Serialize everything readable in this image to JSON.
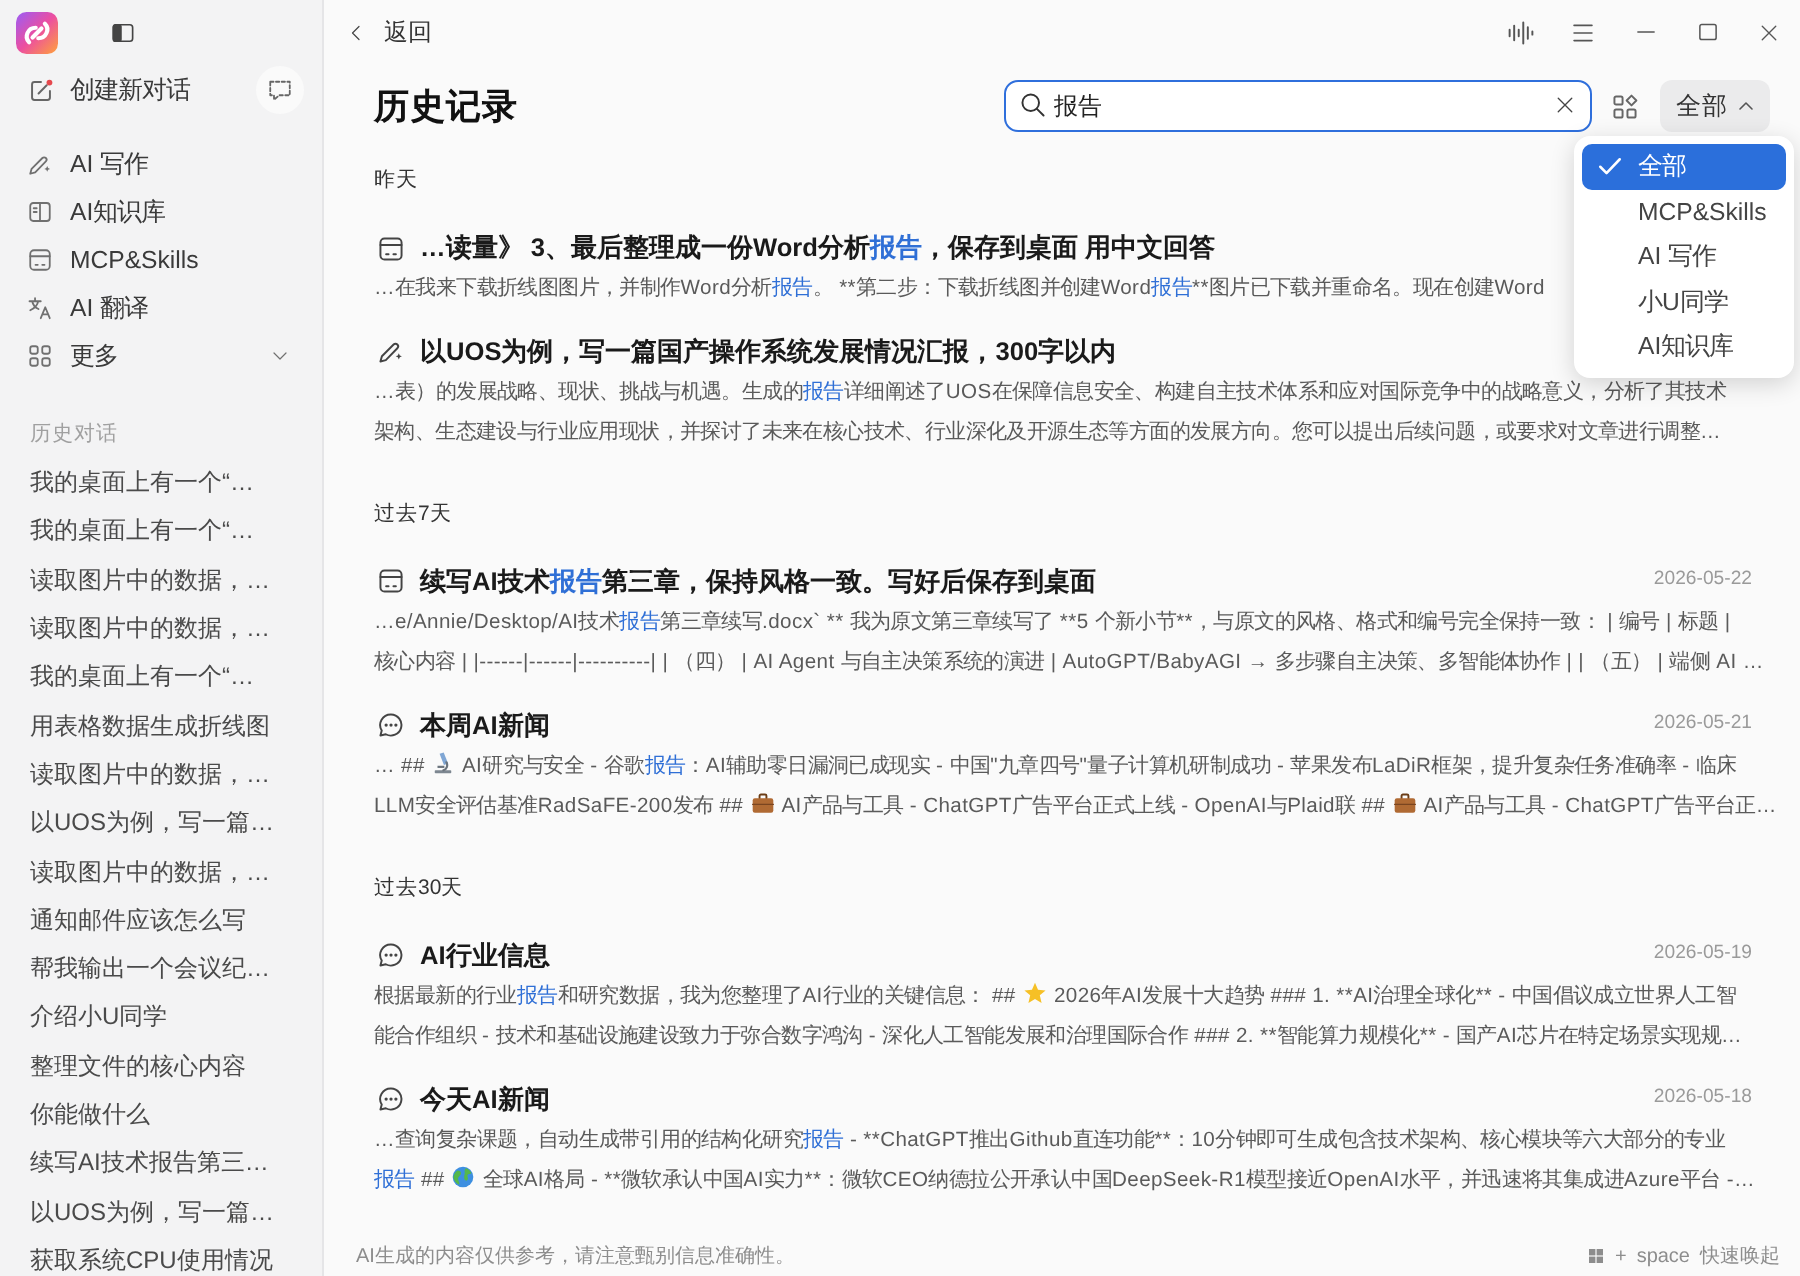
{
  "sidebar": {
    "new_chat": "创建新对话",
    "nav_items": [
      {
        "kind": "writing",
        "label": "AI 写作"
      },
      {
        "kind": "knowledge",
        "label": "AI知识库"
      },
      {
        "kind": "skills",
        "label": "MCP&Skills"
      },
      {
        "kind": "translate",
        "label": "AI 翻译"
      },
      {
        "kind": "more",
        "label": "更多"
      }
    ],
    "history_label": "历史对话",
    "history_items": [
      "我的桌面上有一个“…",
      "我的桌面上有一个“…",
      "读取图片中的数据，…",
      "读取图片中的数据，…",
      "我的桌面上有一个“…",
      "用表格数据生成折线图",
      "读取图片中的数据，…",
      "以UOS为例，写一篇…",
      "读取图片中的数据，…",
      "通知邮件应该怎么写",
      "帮我输出一个会议纪…",
      "介绍小U同学",
      "整理文件的核心内容",
      "你能做什么",
      "续写AI技术报告第三…",
      "以UOS为例，写一篇…",
      "获取系统CPU使用情况"
    ]
  },
  "topbar": {
    "back": "返回"
  },
  "header": {
    "title": "历史记录",
    "search": {
      "value": "报告"
    },
    "filter": {
      "label": "全部",
      "expanded": true,
      "options": [
        {
          "label": "全部",
          "selected": true
        },
        {
          "label": "MCP&Skills",
          "selected": false
        },
        {
          "label": "AI 写作",
          "selected": false
        },
        {
          "label": "小U同学",
          "selected": false
        },
        {
          "label": "AI知识库",
          "selected": false
        }
      ]
    }
  },
  "groups": [
    {
      "label": "昨天",
      "results": [
        {
          "kind": "skills",
          "title": [
            {
              "kind": "text",
              "text": "…读量》 3、最后整理成一份Word分析"
            },
            {
              "kind": "match",
              "text": "报告"
            },
            {
              "kind": "text",
              "text": "，保存到桌面 用中文回答"
            }
          ],
          "snippet_lines": [
            [
              {
                "kind": "text",
                "text": "…在我来下载折线图图片，并制作Word分析"
              },
              {
                "kind": "match",
                "text": "报告"
              },
              {
                "kind": "text",
                "text": "。 **第二步：下载折线图并创建Word"
              },
              {
                "kind": "match",
                "text": "报告"
              },
              {
                "kind": "text",
                "text": "**图片已下载并重命名。现在创建Word"
              }
            ]
          ]
        },
        {
          "kind": "writing",
          "title": [
            {
              "kind": "text",
              "text": "以UOS为例，写一篇国产操作系统发展情况汇报，300字以内"
            }
          ],
          "snippet_lines": [
            [
              {
                "kind": "text",
                "text": "…表）的发展战略、现状、挑战与机遇。生成的"
              },
              {
                "kind": "match",
                "text": "报告"
              },
              {
                "kind": "text",
                "text": "详细阐述了UOS在保障信息安全、构建自主技术体系和应对国际竞争中的战略意义，分析了其技术"
              }
            ],
            [
              {
                "kind": "text",
                "text": "架构、生态建设与行业应用现状，并探讨了未来在核心技术、行业深化及开源生态等方面的发展方向。您可以提出后续问题，或要求对文章进行调整…"
              }
            ]
          ]
        }
      ]
    },
    {
      "label": "过去7天",
      "results": [
        {
          "kind": "skills",
          "date": "2026-05-22",
          "title": [
            {
              "kind": "text",
              "text": "续写AI技术"
            },
            {
              "kind": "match",
              "text": "报告"
            },
            {
              "kind": "text",
              "text": "第三章，保持风格一致。写好后保存到桌面"
            }
          ],
          "snippet_lines": [
            [
              {
                "kind": "text",
                "text": "…e/Annie/Desktop/AI技术"
              },
              {
                "kind": "match",
                "text": "报告"
              },
              {
                "kind": "text",
                "text": "第三章续写.docx` ** 我为原文第三章续写了 **5 个新小节**，与原文的风格、格式和编号完全保持一致： | 编号 | 标题 |"
              }
            ],
            [
              {
                "kind": "text",
                "text": "核心内容 | |------|------|----------| | （四） | AI Agent 与自主决策系统的演进 | AutoGPT/BabyAGI → 多步骤自主决策、多智能体协作 | | （五） | 端侧 AI …"
              }
            ]
          ]
        },
        {
          "kind": "chat",
          "date": "2026-05-21",
          "title": [
            {
              "kind": "text",
              "text": "本周AI新闻"
            }
          ],
          "snippet_lines": [
            [
              {
                "kind": "text",
                "text": "… ## "
              },
              {
                "kind": "microscope"
              },
              {
                "kind": "text",
                "text": " AI研究与安全 - 谷歌"
              },
              {
                "kind": "match",
                "text": "报告"
              },
              {
                "kind": "text",
                "text": "：AI辅助零日漏洞已成现实 - 中国\"九章四号\"量子计算机研制成功 - 苹果发布LaDiR框架，提升复杂任务准确率 - 临床"
              }
            ],
            [
              {
                "kind": "text",
                "text": "LLM安全评估基准RadSaFE-200发布 ## "
              },
              {
                "kind": "briefcase"
              },
              {
                "kind": "text",
                "text": " AI产品与工具 - ChatGPT广告平台正式上线 - OpenAI与Plaid联 ## "
              },
              {
                "kind": "briefcase"
              },
              {
                "kind": "text",
                "text": " AI产品与工具 - ChatGPT广告平台正…"
              }
            ]
          ]
        }
      ]
    },
    {
      "label": "过去30天",
      "results": [
        {
          "kind": "chat",
          "date": "2026-05-19",
          "title": [
            {
              "kind": "text",
              "text": "AI行业信息"
            }
          ],
          "snippet_lines": [
            [
              {
                "kind": "text",
                "text": "根据最新的行业"
              },
              {
                "kind": "match",
                "text": "报告"
              },
              {
                "kind": "text",
                "text": "和研究数据，我为您整理了AI行业的关键信息： ## "
              },
              {
                "kind": "star"
              },
              {
                "kind": "text",
                "text": " 2026年AI发展十大趋势 ### 1. **AI治理全球化** - 中国倡议成立世界人工智"
              }
            ],
            [
              {
                "kind": "text",
                "text": "能合作组织 - 技术和基础设施建设致力于弥合数字鸿沟 - 深化人工智能发展和治理国际合作 ### 2. **智能算力规模化** - 国产AI芯片在特定场景实现规…"
              }
            ]
          ]
        },
        {
          "kind": "chat",
          "date": "2026-05-18",
          "title": [
            {
              "kind": "text",
              "text": "今天AI新闻"
            }
          ],
          "snippet_lines": [
            [
              {
                "kind": "text",
                "text": "…查询复杂课题，自动生成带引用的结构化研究"
              },
              {
                "kind": "match",
                "text": "报告"
              },
              {
                "kind": "text",
                "text": " - **ChatGPT推出Github直连功能**：10分钟即可生成包含技术架构、核心模块等六大部分的专业"
              }
            ],
            [
              {
                "kind": "match",
                "text": "报告"
              },
              {
                "kind": "text",
                "text": " ## "
              },
              {
                "kind": "globe"
              },
              {
                "kind": "text",
                "text": " 全球AI格局 - **微软承认中国AI实力**：微软CEO纳德拉公开承认中国DeepSeek-R1模型接近OpenAI水平，并迅速将其集成进Azure平台 -…"
              }
            ]
          ]
        }
      ]
    }
  ],
  "footer": {
    "disclaimer": "AI生成的内容仅供参考，请注意甄别信息准确性。",
    "shortcut": {
      "parts": [
        "+",
        "space"
      ],
      "action": "快速唤起"
    }
  }
}
